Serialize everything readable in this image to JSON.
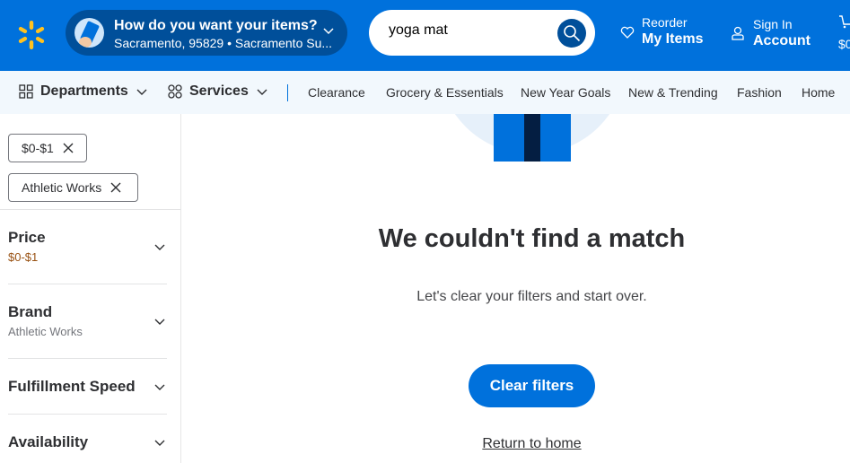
{
  "header": {
    "fulfillment_title": "How do you want your items?",
    "fulfillment_location": "Sacramento, 95829 • Sacramento Su...",
    "search_value": "yoga mat",
    "reorder_small": "Reorder",
    "reorder_big": "My Items",
    "signin_small": "Sign In",
    "signin_big": "Account",
    "cart_total": "$0",
    "brand_color": "#0071dc",
    "spark_color": "#ffc220"
  },
  "nav": {
    "departments": "Departments",
    "services": "Services",
    "links": [
      "Clearance",
      "Grocery & Essentials",
      "New Year Goals",
      "New & Trending",
      "Fashion",
      "Home"
    ]
  },
  "sidebar": {
    "chips": [
      "$0-$1",
      "Athletic Works"
    ],
    "facets": [
      {
        "label": "Price",
        "value": "$0-$1"
      },
      {
        "label": "Brand",
        "value": "Athletic Works"
      },
      {
        "label": "Fulfillment Speed"
      },
      {
        "label": "Availability"
      }
    ]
  },
  "main": {
    "title": "We couldn't find a match",
    "message": "Let's clear your filters and start over.",
    "clear_button": "Clear filters",
    "home_link": "Return to home"
  }
}
